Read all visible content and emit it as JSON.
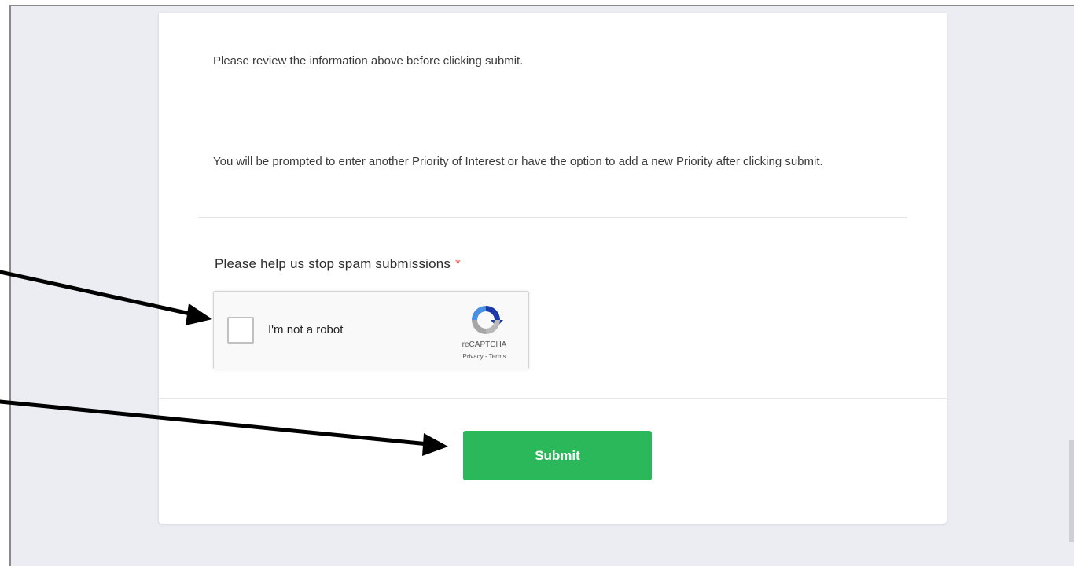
{
  "form": {
    "notice_review": "Please review the information above before clicking submit.",
    "notice_priority": "You will be prompted to enter another Priority of Interest or have the option to add a new Priority after clicking submit.",
    "captcha_label": "Please help us stop spam submissions",
    "required_marker": "*",
    "submit_label": "Submit"
  },
  "recaptcha": {
    "checkbox_label": "I'm not a robot",
    "brand": "reCAPTCHA",
    "links": "Privacy - Terms",
    "logo_icon": "recaptcha-logo-icon"
  },
  "colors": {
    "submit_green": "#2ab85a",
    "required_red": "#e44747",
    "page_background": "#ecedf3"
  }
}
